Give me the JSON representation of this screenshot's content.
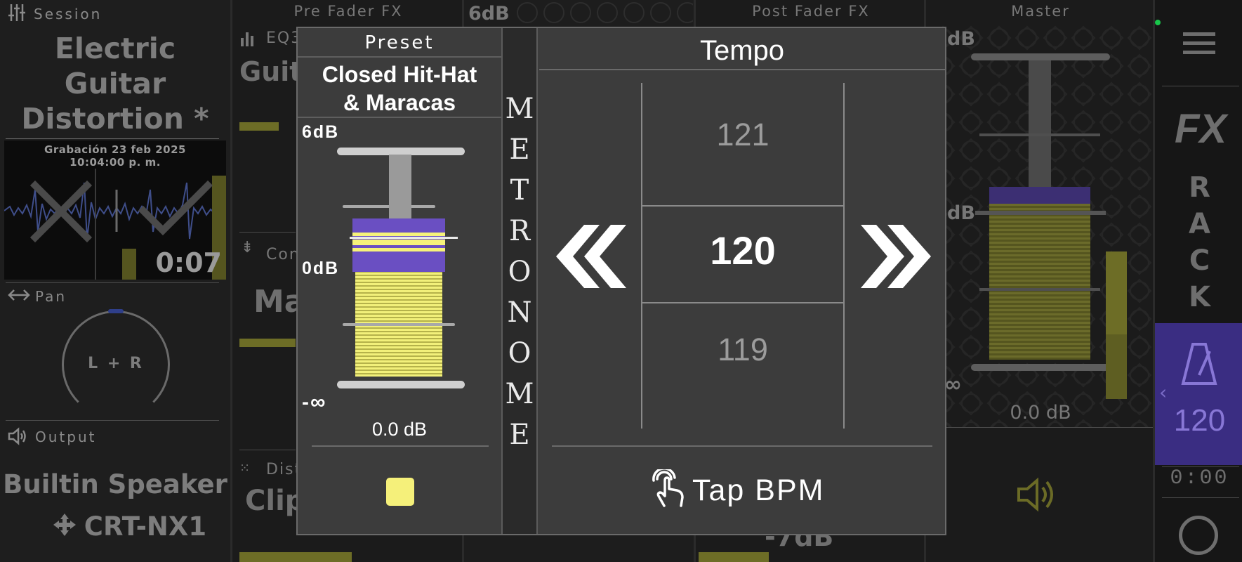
{
  "left_panel": {
    "session_label": "Session",
    "session_title_lines": [
      "Electric",
      "Guitar",
      "Distortion  *"
    ],
    "recording_date": "Grabación 23 feb 2025",
    "recording_time": "10:04:00 p. m.",
    "recording_duration": "0:07",
    "pan_label": "Pan",
    "pan_value": "L + R",
    "output_label": "Output",
    "output_device": "Builtin Speaker",
    "output_device_2": "CRT-NX1"
  },
  "columns": {
    "pre_fader_fx": "Pre Fader FX",
    "post_fader_fx": "Post Fader FX",
    "master": "Master",
    "top_db": "6dB",
    "eq_label": "EQ3",
    "eq_value": "Guit",
    "comp_label": "Con",
    "comp_value": "Ma",
    "dist_label": "Dist",
    "dist_value": "Clip",
    "bottom_db": "-7dB",
    "master_db": "0.0 dB",
    "master_top_db": "dB",
    "master_mid_db": "dB",
    "master_inf": "∞"
  },
  "right_rail": {
    "fx_label": "FX",
    "rack_letters": [
      "R",
      "A",
      "C",
      "K"
    ],
    "tempo_value": "120",
    "time_value": "0:00"
  },
  "dialog": {
    "preset_header": "Preset",
    "preset_name_lines": [
      "Closed Hit-Hat",
      "& Maracas"
    ],
    "db_top": "6dB",
    "db_mid": "0dB",
    "db_bottom": "-∞",
    "db_value": "0.0 dB",
    "swatch_color": "#f5f07a",
    "metronome_letters": [
      "M",
      "E",
      "T",
      "R",
      "O",
      "N",
      "O",
      "M",
      "E"
    ],
    "tempo_title": "Tempo",
    "tempo_prev": "121",
    "tempo_current": "120",
    "tempo_next": "119",
    "tap_label": "Tap BPM",
    "fader_level_fraction": 0.62
  }
}
